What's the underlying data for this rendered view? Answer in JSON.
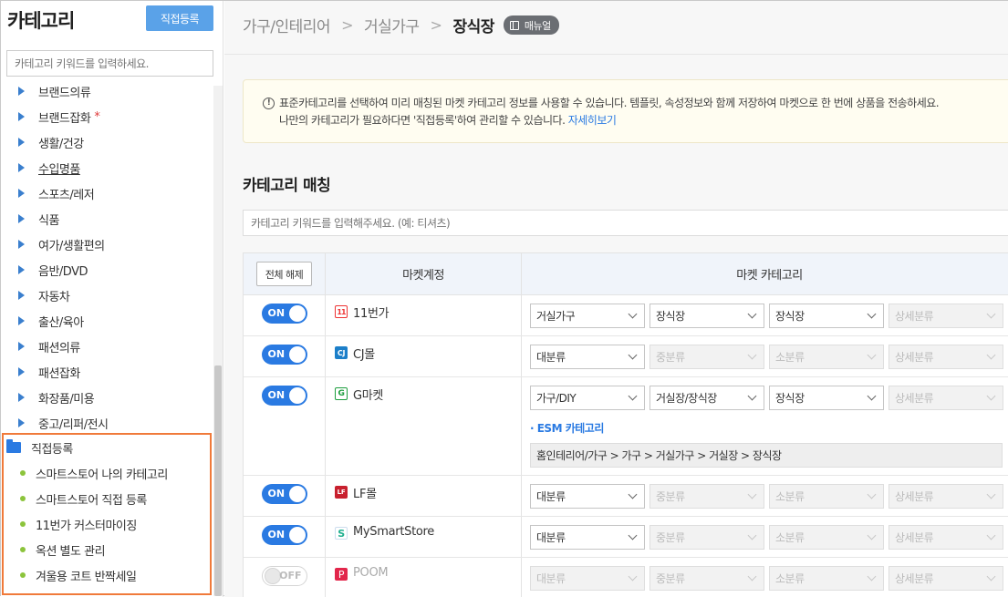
{
  "sidebar": {
    "title": "카테고리",
    "register_button": "직접등록",
    "search_placeholder": "카테고리 키워드를 입력하세요.",
    "items": [
      {
        "label": "브랜드의류"
      },
      {
        "label": "브랜드잡화",
        "star": "*"
      },
      {
        "label": "생활/건강"
      },
      {
        "label": "수입명품"
      },
      {
        "label": "스포츠/레저"
      },
      {
        "label": "식품"
      },
      {
        "label": "여가/생활편의"
      },
      {
        "label": "음반/DVD"
      },
      {
        "label": "자동차"
      },
      {
        "label": "출산/육아"
      },
      {
        "label": "패션의류"
      },
      {
        "label": "패션잡화"
      },
      {
        "label": "화장품/미용"
      },
      {
        "label": "중고/리퍼/전시"
      }
    ],
    "custom": {
      "heading": "직접등록",
      "items": [
        "스마트스토어 나의 카테고리",
        "스마트스토어 직접 등록",
        "11번가 커스터마이징",
        "옥션 별도 관리",
        "겨울용 코트 반짝세일"
      ]
    }
  },
  "breadcrumb": {
    "items": [
      "가구/인테리어",
      "거실가구"
    ],
    "current": "장식장",
    "manual_badge": "매뉴얼"
  },
  "notice": {
    "line1": "표준카테고리를 선택하여 미리 매칭된 마켓 카테고리 정보를 사용할 수 있습니다. 템플릿, 속성정보와 함께 저장하여 마켓으로 한 번에 상품을 전송하세요.",
    "line2": "나만의 카테고리가 필요하다면 '직접등록'하여 관리할 수 있습니다.",
    "link": "자세히보기"
  },
  "matching": {
    "title": "카테고리 매칭",
    "search_placeholder": "카테고리 키워드를 입력해주세요. (예: 티셔츠)",
    "table": {
      "clear_all": "전체 해제",
      "col_account": "마켓계정",
      "col_category": "마켓 카테고리"
    },
    "rows": [
      {
        "toggle": "ON",
        "market": "11번가",
        "logo": "11",
        "selects": [
          "거실가구",
          "장식장",
          "장식장",
          "상세분류"
        ]
      },
      {
        "toggle": "ON",
        "market": "CJ몰",
        "logo": "CJ",
        "selects": [
          "대분류",
          "중분류",
          "소분류",
          "상세분류"
        ]
      },
      {
        "toggle": "ON",
        "market": "G마켓",
        "logo": "G",
        "selects": [
          "가구/DIY",
          "거실장/장식장",
          "장식장",
          "상세분류"
        ],
        "esm_label": "· ESM 카테고리",
        "esm_path": "홈인테리어/가구 > 가구 > 거실가구 > 거실장 > 장식장"
      },
      {
        "toggle": "ON",
        "market": "LF몰",
        "logo": "LF",
        "selects": [
          "대분류",
          "중분류",
          "소분류",
          "상세분류"
        ]
      },
      {
        "toggle": "ON",
        "market": "MySmartStore",
        "logo": "S",
        "selects": [
          "대분류",
          "중분류",
          "소분류",
          "상세분류"
        ]
      },
      {
        "toggle": "OFF",
        "market": "POOM",
        "logo": "P",
        "selects": [
          "대분류",
          "중분류",
          "소분류",
          "상세분류"
        ]
      }
    ]
  },
  "colors": {
    "accent": "#2a7ae2",
    "register_button": "#5aa2e8",
    "highlight_border": "#f07a3a",
    "bullet": "#8cc43c"
  }
}
